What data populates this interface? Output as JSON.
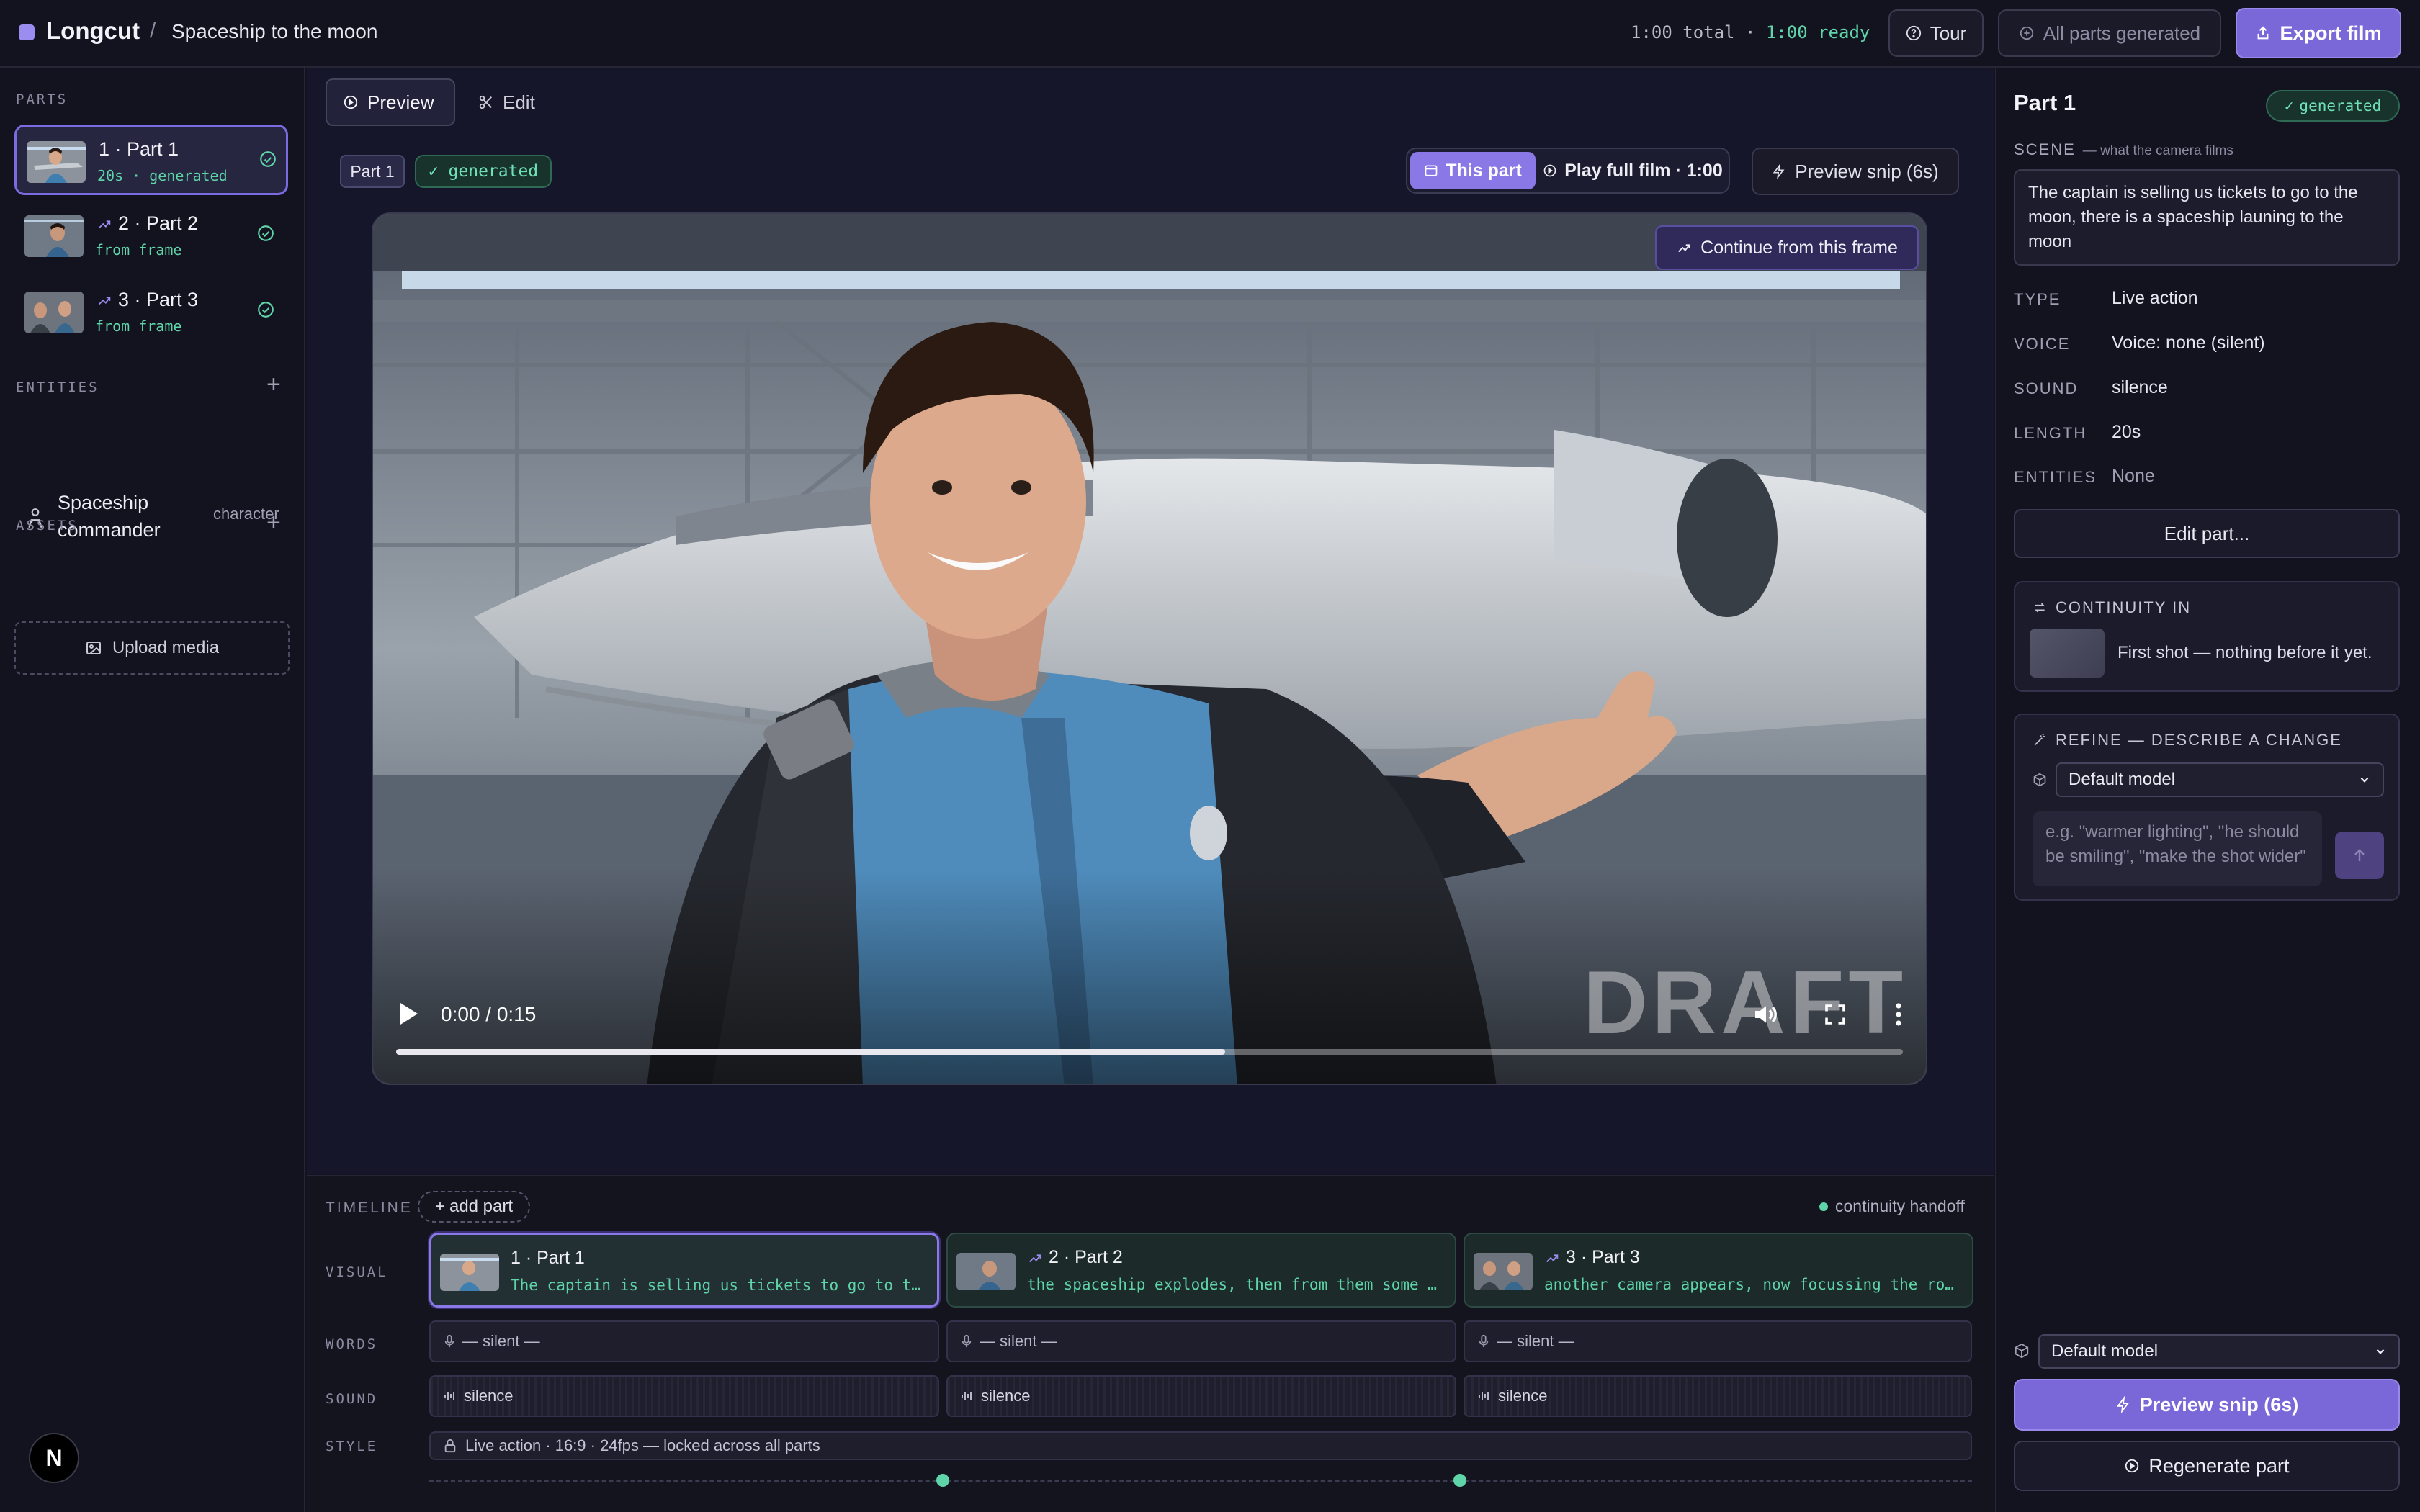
{
  "header": {
    "brand": "Longcut",
    "separator": "/",
    "project_title": "Spaceship to the moon",
    "total": "1:00 total",
    "dot": "·",
    "ready": "1:00 ready",
    "tour_label": "Tour",
    "all_parts_label": "All parts generated",
    "export_label": "Export film"
  },
  "sidebar": {
    "parts_label": "PARTS",
    "parts": [
      {
        "title": "1 · Part 1",
        "sub": "20s · generated"
      },
      {
        "title": "2 · Part 2",
        "sub": "from frame"
      },
      {
        "title": "3 · Part 3",
        "sub": "from frame"
      }
    ],
    "entities_label": "ENTITIES",
    "entities": [
      {
        "name": "Spaceship commander",
        "type": "character"
      }
    ],
    "assets_label": "ASSETS",
    "upload_label": "Upload media"
  },
  "main": {
    "tabs": [
      {
        "label": "Preview"
      },
      {
        "label": "Edit"
      }
    ],
    "part_chip": "Part 1",
    "status_chip": "generated",
    "this_part_label": "This part",
    "play_full_label": "Play full film · 1:00",
    "preview_snip_label": "Preview snip (6s)",
    "continue_label": "Continue from this frame",
    "watermark": "DRAFT",
    "video_time": "0:00 / 0:15",
    "video_progress": 0.55
  },
  "timeline": {
    "label": "TIMELINE",
    "add_part_label": "add part",
    "handoff_label": "continuity handoff",
    "visual_label": "VISUAL",
    "words_label": "WORDS",
    "sound_label": "SOUND",
    "style_label": "STYLE",
    "clips": [
      {
        "title": "1 · Part 1",
        "desc": "The captain is selling us tickets to go to the moon, there is a spaceship launing to the moon"
      },
      {
        "title": "2 · Part 2",
        "desc": "the spaceship explodes, then from them some robots come out"
      },
      {
        "title": "3 · Part 3",
        "desc": "another camera appears, now focussing the robots in detail"
      }
    ],
    "words": [
      "— silent —",
      "— silent —",
      "— silent —"
    ],
    "sounds": [
      "silence",
      "silence",
      "silence"
    ],
    "style_text": "Live action · 16:9 · 24fps — locked across all parts"
  },
  "right": {
    "title": "Part 1",
    "status": "generated",
    "scene_label": "SCENE",
    "scene_hint": "— what the camera films",
    "scene_text": "The captain is selling us tickets to go to the moon, there is a spaceship launing to the moon",
    "fields": [
      {
        "key": "TYPE",
        "value": "Live action"
      },
      {
        "key": "VOICE",
        "value": "Voice: none (silent)"
      },
      {
        "key": "SOUND",
        "value": "silence"
      },
      {
        "key": "LENGTH",
        "value": "20s"
      },
      {
        "key": "ENTITIES",
        "value": "None"
      }
    ],
    "edit_label": "Edit part...",
    "continuity_label": "CONTINUITY IN",
    "continuity_text": "First shot — nothing before it yet.",
    "refine_label": "REFINE — DESCRIBE A CHANGE",
    "model_option": "Default model",
    "refine_placeholder": "e.g. \"warmer lighting\", \"he should be smiling\", \"make the shot wider\"",
    "bottom_model_option": "Default model",
    "snip_label": "Preview snip (6s)",
    "regen_label": "Regenerate part"
  },
  "badge": "N",
  "colors": {
    "accent": "#7b68d8",
    "success": "#5fd4a8",
    "background": "#13131f"
  }
}
